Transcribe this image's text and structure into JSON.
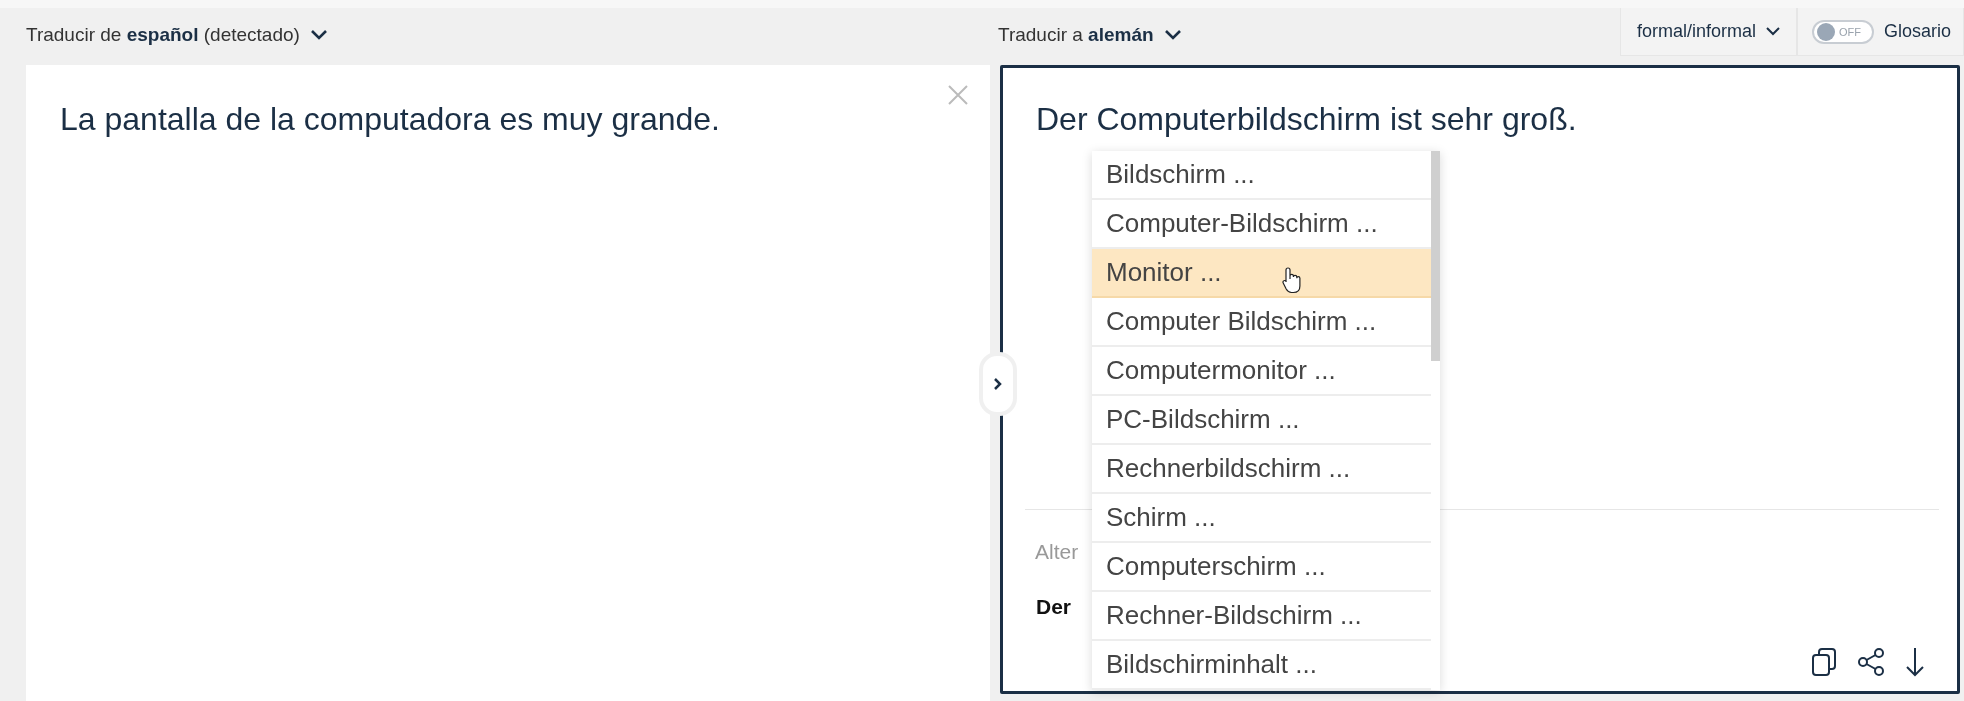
{
  "source": {
    "language_label": "Traducir de **español** (detectado)",
    "text": "La pantalla de la computadora es muy grande."
  },
  "target": {
    "language_label": "Traducir a **alemán**",
    "formality": "formal/informal",
    "glossary": {
      "toggle_text": "OFF",
      "on": false,
      "label": "Glosario"
    },
    "text": "Der Computerbildschirm ist sehr groß.",
    "alternatives_label": "Alter",
    "alternative": "Der"
  },
  "dropdown": {
    "items": [
      {
        "label": "Bildschirm ...",
        "selected": false
      },
      {
        "label": "Computer-Bildschirm ...",
        "selected": false
      },
      {
        "label": "Monitor ...",
        "selected": true
      },
      {
        "label": "Computer Bildschirm ...",
        "selected": false
      },
      {
        "label": "Computermonitor ...",
        "selected": false
      },
      {
        "label": "PC-Bildschirm ...",
        "selected": false
      },
      {
        "label": "Rechnerbildschirm ...",
        "selected": false
      },
      {
        "label": "Schirm ...",
        "selected": false
      },
      {
        "label": "Computerschirm ...",
        "selected": false
      },
      {
        "label": "Rechner-Bildschirm ...",
        "selected": false
      },
      {
        "label": "Bildschirminhalt ...",
        "selected": false
      }
    ]
  }
}
